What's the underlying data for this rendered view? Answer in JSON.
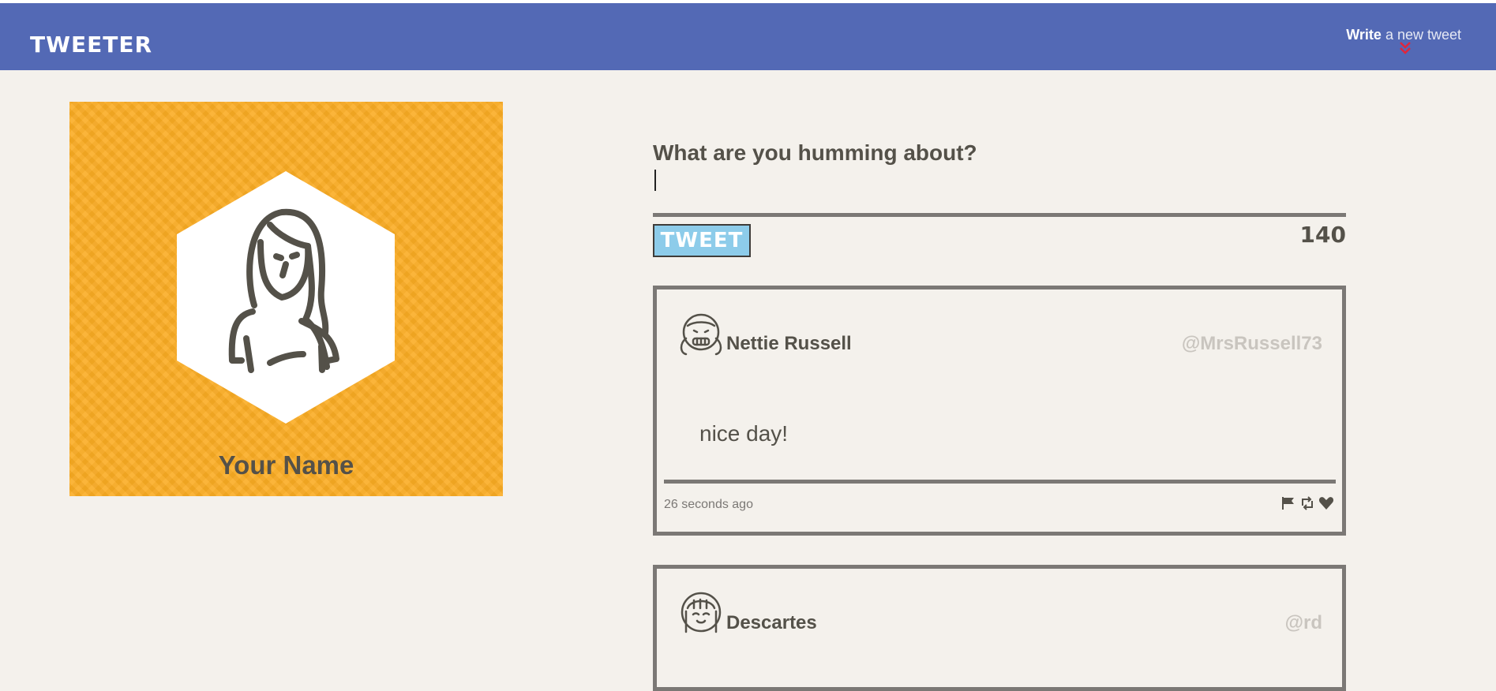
{
  "nav": {
    "brand": "TWEETER",
    "compose_toggle_bold": "Write",
    "compose_toggle_rest": " a new tweet",
    "chevron_icon": "double-chevron-down-icon",
    "chevron_color": "#e0263c"
  },
  "colors": {
    "nav_bg": "#5369b5",
    "page_bg": "#f4f1ec",
    "profile_bg": "#fbac23",
    "tweet_button_bg": "#8dccea",
    "text": "#545149",
    "handle": "#c9c5bf"
  },
  "profile": {
    "name": "Your Name",
    "avatar_icon": "woman-avatar-icon"
  },
  "compose": {
    "label": "What are you humming about?",
    "input_value": "",
    "placeholder": "",
    "submit_label": "TWEET",
    "char_counter": "140"
  },
  "tweets": [
    {
      "name": "Nettie Russell",
      "handle": "@MrsRussell73",
      "body": "nice day!",
      "time": "26 seconds ago",
      "avatar_icon": "girl-pigtails-avatar-icon",
      "actions": [
        "flag-icon",
        "retweet-icon",
        "heart-icon"
      ]
    },
    {
      "name": "Descartes",
      "handle": "@rd",
      "body": "",
      "time": "",
      "avatar_icon": "girl-bangs-avatar-icon",
      "actions": [
        "flag-icon",
        "retweet-icon",
        "heart-icon"
      ]
    }
  ]
}
